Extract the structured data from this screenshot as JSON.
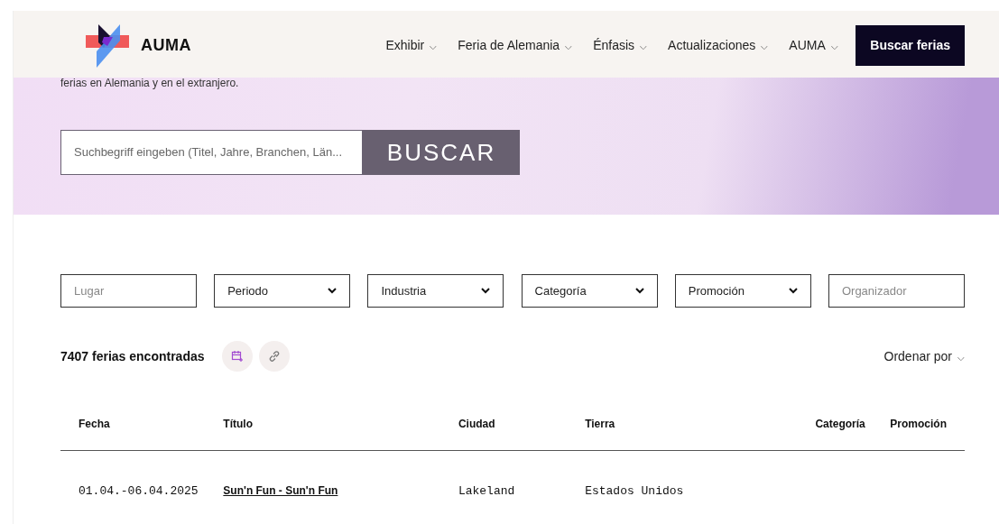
{
  "header": {
    "logo_text": "AUMA",
    "nav": [
      {
        "label": "Exhibir",
        "caret": "⌵"
      },
      {
        "label": "Feria de Alemania",
        "caret": "⌵"
      },
      {
        "label": "Énfasis",
        "caret": "⌵"
      },
      {
        "label": "Actualizaciones",
        "caret": "⌵"
      },
      {
        "label": "AUMA",
        "caret": "⌵"
      }
    ],
    "cta": "Buscar ferias"
  },
  "hero": {
    "subtitle": "ferias en Alemania y en el extranjero.",
    "search": {
      "placeholder": "Suchbegriff eingeben (Titel, Jahre, Branchen, Län...",
      "button": "BUSCAR"
    }
  },
  "filters": [
    {
      "kind": "input",
      "placeholder": "Lugar"
    },
    {
      "kind": "select",
      "label": "Periodo"
    },
    {
      "kind": "select",
      "label": "Industria"
    },
    {
      "kind": "select",
      "label": "Categoría"
    },
    {
      "kind": "select",
      "label": "Promoción"
    },
    {
      "kind": "input",
      "placeholder": "Organizador"
    }
  ],
  "results": {
    "count": "7407 ferias encontradas",
    "sort": "Ordenar por",
    "sort_caret": "⌵"
  },
  "table": {
    "columns": [
      "Fecha",
      "Título",
      "Ciudad",
      "Tierra",
      "Categoría",
      "Promoción"
    ],
    "rows": [
      {
        "cells": [
          "01.04.-06.04.2025",
          "Sun'n Fun - Sun'n Fun",
          "Lakeland",
          "Estados Unidos",
          "",
          ""
        ]
      }
    ]
  }
}
